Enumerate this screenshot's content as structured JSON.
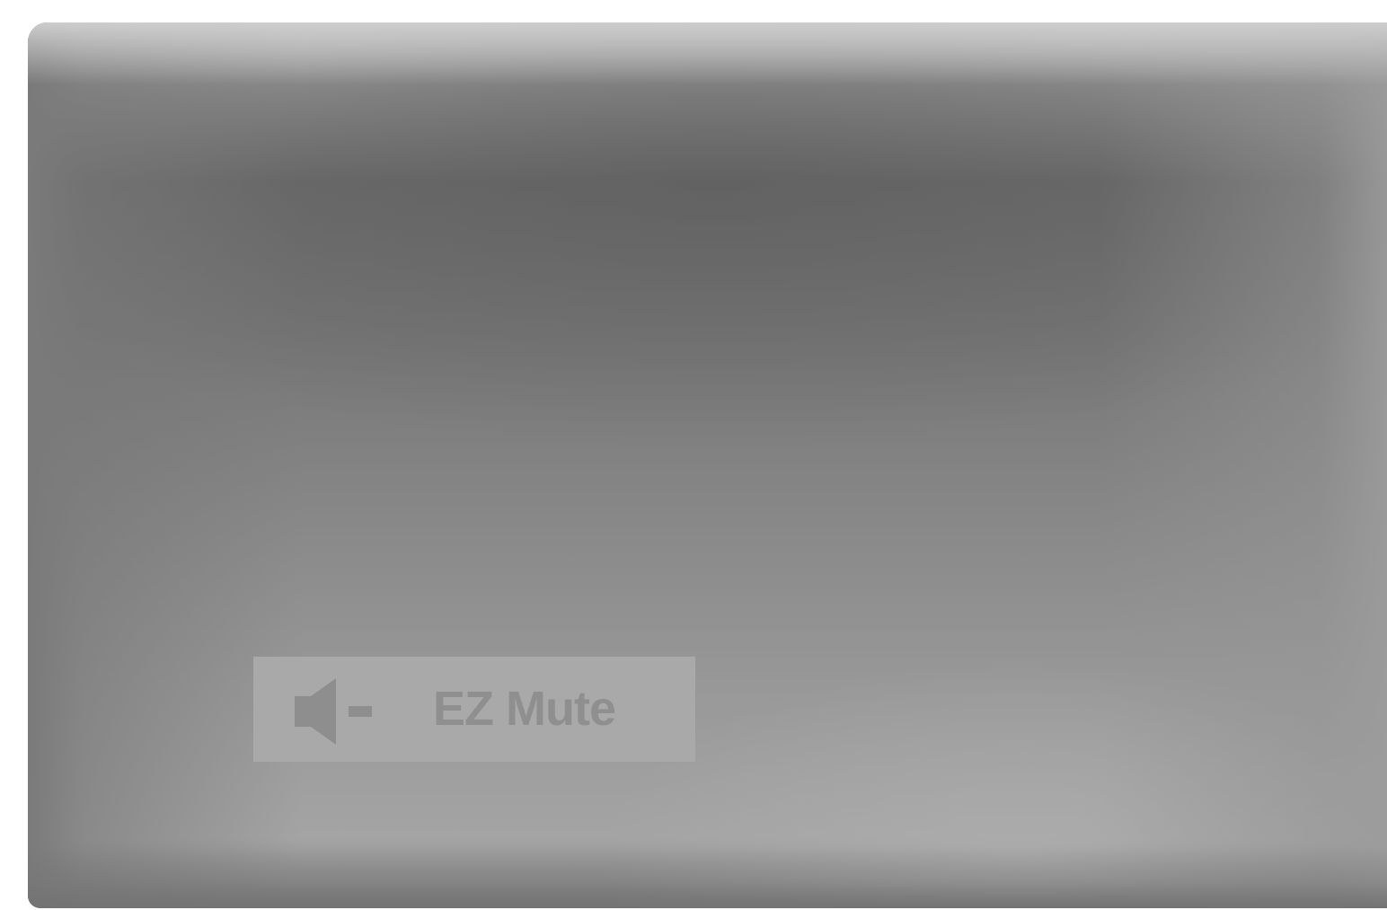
{
  "osd": {
    "icon": "speaker-mute-icon",
    "label": "EZ Mute"
  },
  "colors": {
    "osd_background": "#a9a9a9",
    "osd_text": "#8f8f8f",
    "screen_dark": "#6c6c6c",
    "screen_light": "#a4a4a4"
  }
}
